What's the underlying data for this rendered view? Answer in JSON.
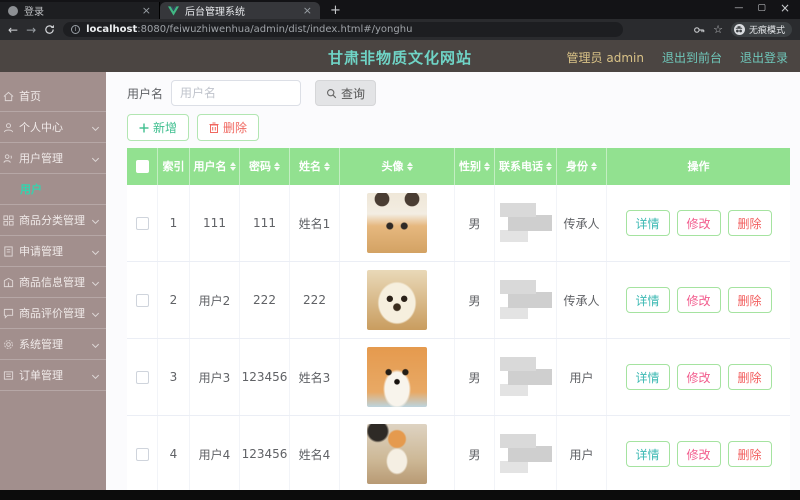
{
  "browser": {
    "tab1": {
      "title": "登录",
      "close": "×"
    },
    "tab2": {
      "title": "后台管理系统",
      "close": "×"
    },
    "new_tab": "+",
    "controls": {
      "minimize": "—",
      "maximize": "▢",
      "close": "×"
    },
    "nav": {
      "back": "←",
      "forward": "→"
    },
    "url_host": "localhost",
    "url_rest": ":8080/feiwuzhiwenhua/admin/dist/index.html#/yonghu",
    "incognito_label": "无痕模式"
  },
  "header": {
    "title": "甘肃非物质文化网站",
    "admin_label": "管理员 admin",
    "link_front": "退出到前台",
    "link_logout": "退出登录"
  },
  "sidebar": {
    "items": [
      {
        "label": "首页",
        "icon": "home-icon",
        "expandable": false
      },
      {
        "label": "个人中心",
        "icon": "profile-icon",
        "expandable": true
      },
      {
        "label": "用户管理",
        "icon": "users-icon",
        "expandable": true
      },
      {
        "label": "用户",
        "icon": null,
        "active": true,
        "submenu": true
      },
      {
        "label": "商品分类管理",
        "icon": "category-icon",
        "expandable": true
      },
      {
        "label": "申请管理",
        "icon": "apply-icon",
        "expandable": true
      },
      {
        "label": "商品信息管理",
        "icon": "goods-icon",
        "expandable": true
      },
      {
        "label": "商品评价管理",
        "icon": "review-icon",
        "expandable": true
      },
      {
        "label": "系统管理",
        "icon": "system-icon",
        "expandable": true
      },
      {
        "label": "订单管理",
        "icon": "order-icon",
        "expandable": true
      }
    ]
  },
  "search": {
    "label": "用户名",
    "placeholder": "用户名",
    "query": "查询"
  },
  "toolbar": {
    "add_label": "新增",
    "delete_label": "删除"
  },
  "table": {
    "headers": {
      "index": "索引",
      "username": "用户名",
      "password": "密码",
      "name": "姓名",
      "avatar": "头像",
      "gender": "性别",
      "phone": "联系电话",
      "identity": "身份",
      "ops": "操作"
    },
    "rows": [
      {
        "index": "1",
        "username": "111",
        "password": "111",
        "name": "姓名1",
        "gender": "男",
        "identity": "传承人"
      },
      {
        "index": "2",
        "username": "用户2",
        "password": "222",
        "name": "222",
        "gender": "男",
        "identity": "传承人"
      },
      {
        "index": "3",
        "username": "用户3",
        "password": "123456",
        "name": "姓名3",
        "gender": "男",
        "identity": "用户"
      },
      {
        "index": "4",
        "username": "用户4",
        "password": "123456",
        "name": "姓名4",
        "gender": "男",
        "identity": "用户"
      }
    ],
    "ops": {
      "detail": "详情",
      "edit": "修改",
      "del": "删除"
    }
  },
  "colors": {
    "table_header_green": "#92e190",
    "sidebar_mauve": "#a28f8d",
    "app_header_bg": "#4b4542",
    "title_teal": "#6fd4c6",
    "admin_gold": "#d9c287",
    "link_teal": "#6fc7ba",
    "active_menu_teal": "#35d3ae",
    "detail_teal": "#3cb9b3",
    "edit_pink": "#f25d8e",
    "delete_red": "#f25d5d",
    "button_border_green": "#b2e6b2"
  }
}
